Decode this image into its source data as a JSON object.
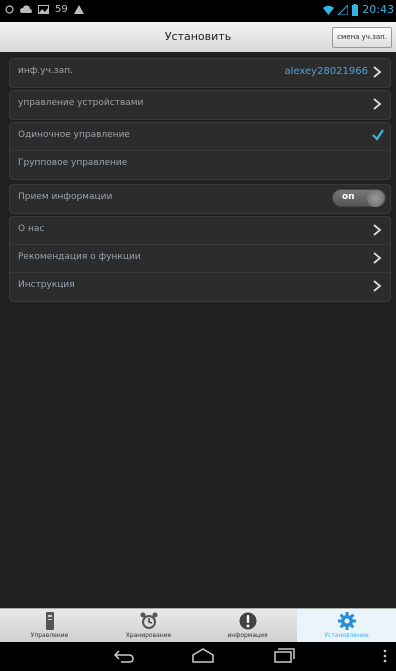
{
  "statusbar": {
    "left_number": "59",
    "time": "20:43"
  },
  "header": {
    "title": "Установить",
    "switch_account_label": "смена уч.зап."
  },
  "groups": {
    "account": {
      "label": "инф.уч.зап.",
      "value": "alexey28021966"
    },
    "device_management": {
      "label": "управление устройствами"
    },
    "control_mode": {
      "single_label": "Одиночное управление",
      "group_label": "Групповое управление",
      "selected": "single"
    },
    "receive_info": {
      "label": "Прием информации",
      "toggle_text": "on",
      "enabled": true
    },
    "about": {
      "items": [
        {
          "label": "О нас"
        },
        {
          "label": "Рекомендация о функции"
        },
        {
          "label": "Инструкция"
        }
      ]
    }
  },
  "tabs": [
    {
      "label": "Управление",
      "icon": "remote-icon"
    },
    {
      "label": "Хранирование",
      "icon": "alarm-clock-icon"
    },
    {
      "label": "информация",
      "icon": "exclamation-icon"
    },
    {
      "label": "Установление",
      "icon": "gear-icon",
      "active": true
    }
  ],
  "colors": {
    "accent": "#33b5e5",
    "link": "#4ba3d8",
    "background": "#202020"
  }
}
